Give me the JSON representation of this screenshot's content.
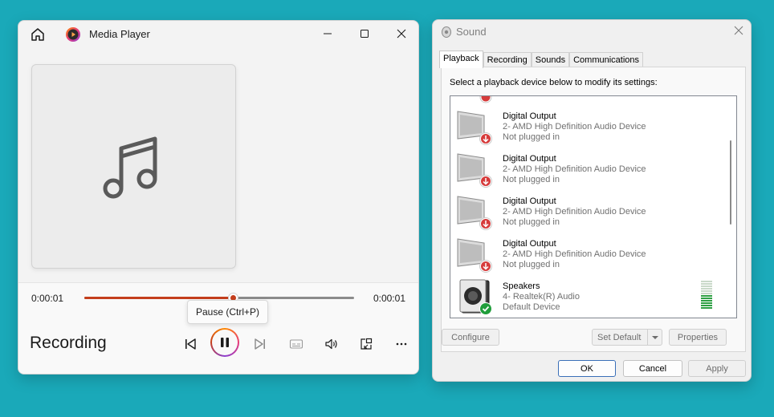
{
  "media_player": {
    "title": "Media Player",
    "time_elapsed": "0:00:01",
    "time_total": "0:00:01",
    "seek_progress": 0.55,
    "tooltip": "Pause (Ctrl+P)",
    "track_name": "Recording",
    "accent_color": "#c43e1c"
  },
  "sound": {
    "title": "Sound",
    "tabs": [
      {
        "label": "Playback",
        "active": true
      },
      {
        "label": "Recording",
        "active": false
      },
      {
        "label": "Sounds",
        "active": false
      },
      {
        "label": "Communications",
        "active": false
      }
    ],
    "instruction": "Select a playback device below to modify its settings:",
    "devices": [
      {
        "name": "Digital Output",
        "description": "2- AMD High Definition Audio Device",
        "status": "Not plugged in",
        "icon": "monitor-speaker-unplugged-icon"
      },
      {
        "name": "Digital Output",
        "description": "2- AMD High Definition Audio Device",
        "status": "Not plugged in",
        "icon": "monitor-speaker-unplugged-icon"
      },
      {
        "name": "Digital Output",
        "description": "2- AMD High Definition Audio Device",
        "status": "Not plugged in",
        "icon": "monitor-speaker-unplugged-icon"
      },
      {
        "name": "Digital Output",
        "description": "2- AMD High Definition Audio Device",
        "status": "Not plugged in",
        "icon": "monitor-speaker-unplugged-icon"
      },
      {
        "name": "Speakers",
        "description": "4- Realtek(R) Audio",
        "status": "Default Device",
        "icon": "speaker-default-icon"
      }
    ],
    "buttons": {
      "configure": "Configure",
      "set_default": "Set Default",
      "properties": "Properties",
      "ok": "OK",
      "cancel": "Cancel",
      "apply": "Apply"
    }
  }
}
